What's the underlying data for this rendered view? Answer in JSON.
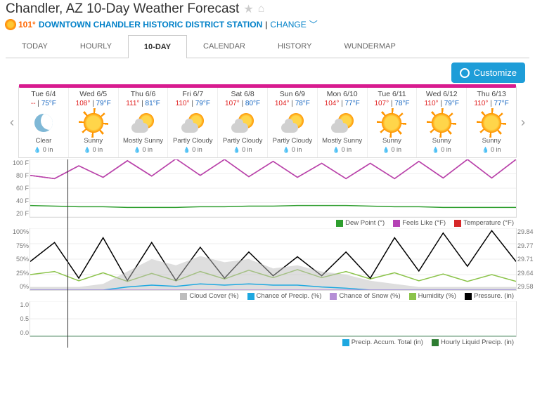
{
  "header": {
    "title": "Chandler, AZ 10-Day Weather Forecast",
    "current_temp": "101°",
    "station": "DOWNTOWN CHANDLER HISTORIC DISTRICT STATION",
    "sep": " | ",
    "change": "CHANGE"
  },
  "tabs": [
    "TODAY",
    "HOURLY",
    "10-DAY",
    "CALENDAR",
    "HISTORY",
    "WUNDERMAP"
  ],
  "active_tab": 2,
  "customize": "Customize",
  "days": [
    {
      "date": "Tue 6/4",
      "hi": "--",
      "lo": "75°F",
      "icon": "moon",
      "cond": "Clear",
      "precip": "0 in",
      "ribbon": "#d81b8f"
    },
    {
      "date": "Wed 6/5",
      "hi": "108°",
      "lo": "79°F",
      "icon": "sun",
      "cond": "Sunny",
      "precip": "0 in",
      "ribbon": "#d81b8f"
    },
    {
      "date": "Thu 6/6",
      "hi": "111°",
      "lo": "81°F",
      "icon": "psun",
      "cond": "Mostly Sunny",
      "precip": "0 in",
      "ribbon": "#d81b8f"
    },
    {
      "date": "Fri 6/7",
      "hi": "110°",
      "lo": "79°F",
      "icon": "psun",
      "cond": "Partly Cloudy",
      "precip": "0 in",
      "ribbon": "#f59b1e"
    },
    {
      "date": "Sat 6/8",
      "hi": "107°",
      "lo": "80°F",
      "icon": "psun",
      "cond": "Partly Cloudy",
      "precip": "0 in",
      "ribbon": "#f59b1e"
    },
    {
      "date": "Sun 6/9",
      "hi": "104°",
      "lo": "78°F",
      "icon": "psun",
      "cond": "Partly Cloudy",
      "precip": "0 in",
      "ribbon": "#d81b8f"
    },
    {
      "date": "Mon 6/10",
      "hi": "104°",
      "lo": "77°F",
      "icon": "psun",
      "cond": "Mostly Sunny",
      "precip": "0 in",
      "ribbon": "#d81b8f"
    },
    {
      "date": "Tue 6/11",
      "hi": "107°",
      "lo": "78°F",
      "icon": "sun",
      "cond": "Sunny",
      "precip": "0 in",
      "ribbon": "#d81b8f"
    },
    {
      "date": "Wed 6/12",
      "hi": "110°",
      "lo": "79°F",
      "icon": "sun",
      "cond": "Sunny",
      "precip": "0 in",
      "ribbon": "#d81b8f"
    },
    {
      "date": "Thu 6/13",
      "hi": "110°",
      "lo": "77°F",
      "icon": "sun",
      "cond": "Sunny",
      "precip": "0 in",
      "ribbon": "#d81b8f"
    }
  ],
  "chart_data": [
    {
      "type": "line",
      "title": "Temperature",
      "ylabel_ticks": [
        "100 F",
        "80 F",
        "60 F",
        "40 F",
        "20 F"
      ],
      "ylim": [
        20,
        110
      ],
      "series": [
        {
          "name": "Temperature (°F)",
          "color": "#d62728",
          "values": [
            85,
            80,
            100,
            82,
            108,
            84,
            111,
            85,
            110,
            83,
            107,
            82,
            104,
            80,
            104,
            80,
            107,
            81,
            110,
            81,
            110
          ]
        },
        {
          "name": "Feels Like (°F)",
          "color": "#b542b5",
          "values": [
            85,
            80,
            100,
            82,
            108,
            84,
            111,
            85,
            110,
            83,
            107,
            82,
            104,
            80,
            104,
            80,
            107,
            81,
            110,
            81,
            110
          ]
        },
        {
          "name": "Dew Point (°)",
          "color": "#2e9e2e",
          "values": [
            38,
            37,
            36,
            36,
            35,
            35,
            35,
            36,
            36,
            37,
            37,
            38,
            38,
            38,
            37,
            36,
            36,
            35,
            35,
            35,
            35
          ]
        }
      ],
      "legend": [
        {
          "label": "Dew Point (°)",
          "color": "#2e9e2e"
        },
        {
          "label": "Feels Like (°F)",
          "color": "#b542b5"
        },
        {
          "label": "Temperature (°F)",
          "color": "#d62728"
        }
      ]
    },
    {
      "type": "line",
      "title": "Humidity/Pressure",
      "ylabel_ticks": [
        "100%",
        "75%",
        "50%",
        "25%",
        "0%"
      ],
      "ylim": [
        0,
        100
      ],
      "y2label_ticks": [
        "29.84",
        "29.77",
        "29.71",
        "29.64",
        "29.58"
      ],
      "series": [
        {
          "name": "Humidity (%)",
          "color": "#8bc34a",
          "values": [
            25,
            30,
            15,
            28,
            14,
            27,
            15,
            30,
            18,
            32,
            20,
            33,
            20,
            30,
            18,
            28,
            15,
            26,
            14,
            25,
            14
          ]
        },
        {
          "name": "Pressure. (in)",
          "color": "#000000",
          "axis": "y2",
          "values": [
            29.7,
            29.78,
            29.63,
            29.8,
            29.62,
            29.78,
            29.62,
            29.76,
            29.63,
            29.74,
            29.64,
            29.72,
            29.64,
            29.74,
            29.63,
            29.8,
            29.66,
            29.82,
            29.68,
            29.83,
            29.7
          ]
        },
        {
          "name": "Cloud Cover (%)",
          "color": "#bdbdbd",
          "fill": true,
          "values": [
            5,
            5,
            5,
            10,
            30,
            50,
            40,
            55,
            45,
            50,
            35,
            40,
            30,
            25,
            15,
            10,
            5,
            5,
            5,
            5,
            5
          ]
        },
        {
          "name": "Chance of Precip. (%)",
          "color": "#1ea8e0",
          "values": [
            0,
            0,
            0,
            0,
            5,
            8,
            6,
            10,
            8,
            10,
            8,
            8,
            5,
            3,
            0,
            0,
            0,
            0,
            0,
            0,
            0
          ]
        },
        {
          "name": "Chance of Snow (%)",
          "color": "#b58fd6",
          "values": [
            0,
            0,
            0,
            0,
            0,
            0,
            0,
            0,
            0,
            0,
            0,
            0,
            0,
            0,
            0,
            0,
            0,
            0,
            0,
            0,
            0
          ]
        }
      ],
      "legend": [
        {
          "label": "Cloud Cover (%)",
          "color": "#bdbdbd"
        },
        {
          "label": "Chance of Precip. (%)",
          "color": "#1ea8e0"
        },
        {
          "label": "Chance of Snow (%)",
          "color": "#b58fd6"
        },
        {
          "label": "Humidity (%)",
          "color": "#8bc34a"
        },
        {
          "label": "Pressure. (in)",
          "color": "#000000"
        }
      ]
    },
    {
      "type": "line",
      "title": "Precip",
      "ylabel_ticks": [
        "1.0",
        "0.5",
        "0.0"
      ],
      "ylim": [
        0,
        1
      ],
      "series": [
        {
          "name": "Precip. Accum. Total (in)",
          "color": "#1ea8e0",
          "values": [
            0,
            0,
            0,
            0,
            0,
            0,
            0,
            0,
            0,
            0,
            0,
            0,
            0,
            0,
            0,
            0,
            0,
            0,
            0,
            0,
            0
          ]
        },
        {
          "name": "Hourly Liquid Precip. (in)",
          "color": "#2e7d32",
          "values": [
            0,
            0,
            0,
            0,
            0,
            0,
            0,
            0,
            0,
            0,
            0,
            0,
            0,
            0,
            0,
            0,
            0,
            0,
            0,
            0,
            0
          ]
        }
      ],
      "legend": [
        {
          "label": "Precip. Accum. Total (in)",
          "color": "#1ea8e0"
        },
        {
          "label": "Hourly Liquid Precip. (in)",
          "color": "#2e7d32"
        }
      ]
    }
  ]
}
